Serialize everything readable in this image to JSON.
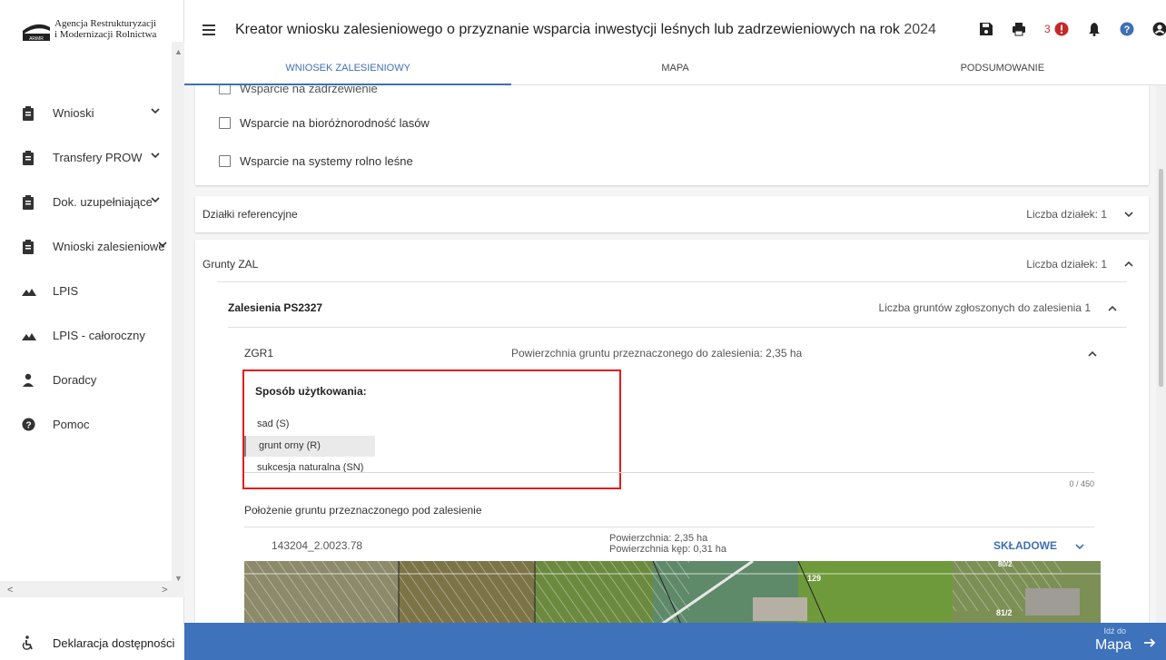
{
  "brand": {
    "line1": "Agencja Restrukturyzacji",
    "line2": "i Modernizacji Rolnictwa",
    "mark": "ARiMR"
  },
  "sidebar": {
    "items": [
      {
        "label": "Wnioski",
        "icon": "clipboard-icon",
        "chevron": true
      },
      {
        "label": "Transfery PROW",
        "icon": "clipboard-icon",
        "chevron": true
      },
      {
        "label": "Dok. uzupełniające",
        "icon": "clipboard-icon",
        "chevron": true
      },
      {
        "label": "Wnioski zalesieniowe",
        "icon": "clipboard-icon",
        "chevron": true
      },
      {
        "label": "LPIS",
        "icon": "mountain-icon",
        "chevron": false
      },
      {
        "label": "LPIS - całoroczny",
        "icon": "mountain-icon",
        "chevron": false
      },
      {
        "label": "Doradcy",
        "icon": "person-icon",
        "chevron": false
      },
      {
        "label": "Pomoc",
        "icon": "help-icon",
        "chevron": false
      }
    ],
    "declaration": "Deklaracja dostępności"
  },
  "header": {
    "title": "Kreator wniosku zalesieniowego o przyznanie wsparcia inwestycji leśnych lub zadrzewieniowych na rok",
    "year": "2024",
    "error_count": "3"
  },
  "tabs": [
    {
      "label": "WNIOSEK ZALESIENIOWY",
      "active": true
    },
    {
      "label": "MAPA",
      "active": false
    },
    {
      "label": "PODSUMOWANIE",
      "active": false
    }
  ],
  "support": {
    "partial": "Wsparcie na zadrzewienie",
    "options": [
      "Wsparcie na bioróżnorodność lasów",
      "Wsparcie na systemy rolno leśne"
    ]
  },
  "dzialki": {
    "title": "Działki referencyjne",
    "count_label": "Liczba działek: 1"
  },
  "grunty": {
    "title": "Grunty ZAL",
    "count_label": "Liczba działek: 1",
    "zalesienia": {
      "title": "Zalesienia PS2327",
      "count_label": "Liczba gruntów zgłoszonych do zalesienia 1",
      "zgr": {
        "title": "ZGR1",
        "area_label": "Powierzchnia gruntu przeznaczonego do zalesienia: 2,35 ha",
        "usage_label": "Sposób użytkowania:",
        "usage_options": [
          "sad (S)",
          "grunt orny (R)",
          "sukcesja naturalna (SN)"
        ],
        "selected_index": 1,
        "counter": "0 / 450",
        "location_title": "Położenie gruntu przeznaczonego pod zalesienie",
        "parcel": {
          "id": "143204_2.0023.78",
          "area": "Powierzchnia: 2,35 ha",
          "clump_area": "Powierzchnia kęp: 0,31 ha",
          "components_label": "SKŁADOWE"
        },
        "map_labels": [
          "129",
          "81/2",
          "80/2"
        ]
      }
    }
  },
  "footer": {
    "go_small": "Idź do",
    "go_big": "Mapa"
  },
  "colors": {
    "accent": "#3f6fb5",
    "bottom_bar": "#3e72bb",
    "highlight": "#e41b1b",
    "error": "#d32f2f"
  }
}
